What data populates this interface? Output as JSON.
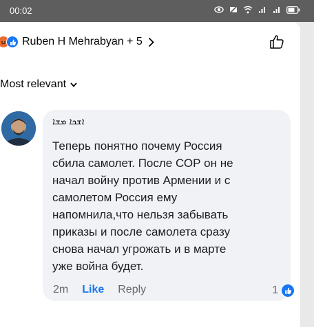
{
  "status_bar": {
    "time": "00:02",
    "icons": [
      "eye-icon",
      "mute-icon",
      "wifi-icon",
      "signal-icon",
      "signal-icon",
      "battery-icon"
    ]
  },
  "reactions_header": {
    "icons": [
      "angry-reaction-icon",
      "like-reaction-icon"
    ],
    "text": "Ruben H Mehrabyan + 5"
  },
  "sort": {
    "label": "Most relevant"
  },
  "comment": {
    "author": "ܐܫܟܐ ܡܫܐ",
    "lines": [
      "Теперь понятно почему Россия",
      "сбила самолет. После СОР он не",
      "начал войну против Армении и с",
      "самолетом Россия ему",
      "напомнила,что нельзя забывать",
      "приказы и после самолета сразу",
      "снова начал угрожать и в марте",
      "уже война будет."
    ],
    "time": "2m",
    "like_label": "Like",
    "reply_label": "Reply",
    "like_count": "1"
  },
  "colors": {
    "accent": "#1877f2",
    "angry": "#ea6b2e",
    "status_bar": "#5e5e5e",
    "bubble": "#f0f2f5",
    "muted_text": "#65676b"
  }
}
